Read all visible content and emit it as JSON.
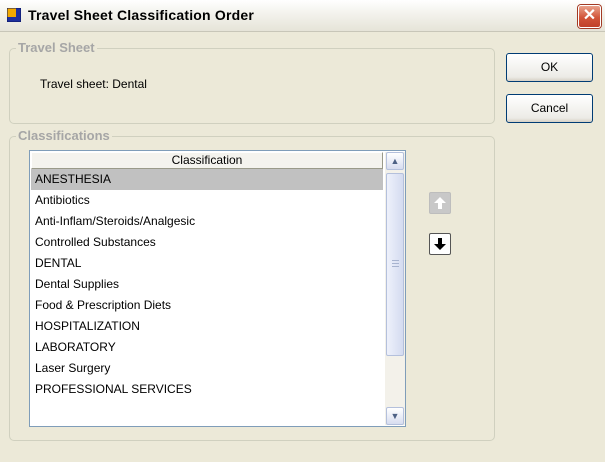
{
  "window": {
    "title": "Travel Sheet Classification Order",
    "icon": "app-window-icon",
    "close_label": "✕"
  },
  "travel_sheet_group": {
    "legend": "Travel Sheet",
    "label": "Travel sheet: Dental"
  },
  "buttons": {
    "ok": "OK",
    "cancel": "Cancel"
  },
  "classifications_group": {
    "legend": "Classifications",
    "column_header": "Classification",
    "items": [
      "ANESTHESIA",
      "Antibiotics",
      "Anti-Inflam/Steroids/Analgesic",
      "Controlled Substances",
      "DENTAL",
      "Dental Supplies",
      "Food & Prescription Diets",
      "HOSPITALIZATION",
      "LABORATORY",
      "Laser Surgery",
      "PROFESSIONAL SERVICES"
    ],
    "selected_index": 0
  },
  "move_buttons": {
    "up_icon": "arrow-up-icon",
    "down_icon": "arrow-down-icon",
    "up_enabled": false,
    "down_enabled": true
  },
  "colors": {
    "selection": "#c1c1c1",
    "dialog_bg": "#ece9d8",
    "close_button": "#d2553a"
  }
}
